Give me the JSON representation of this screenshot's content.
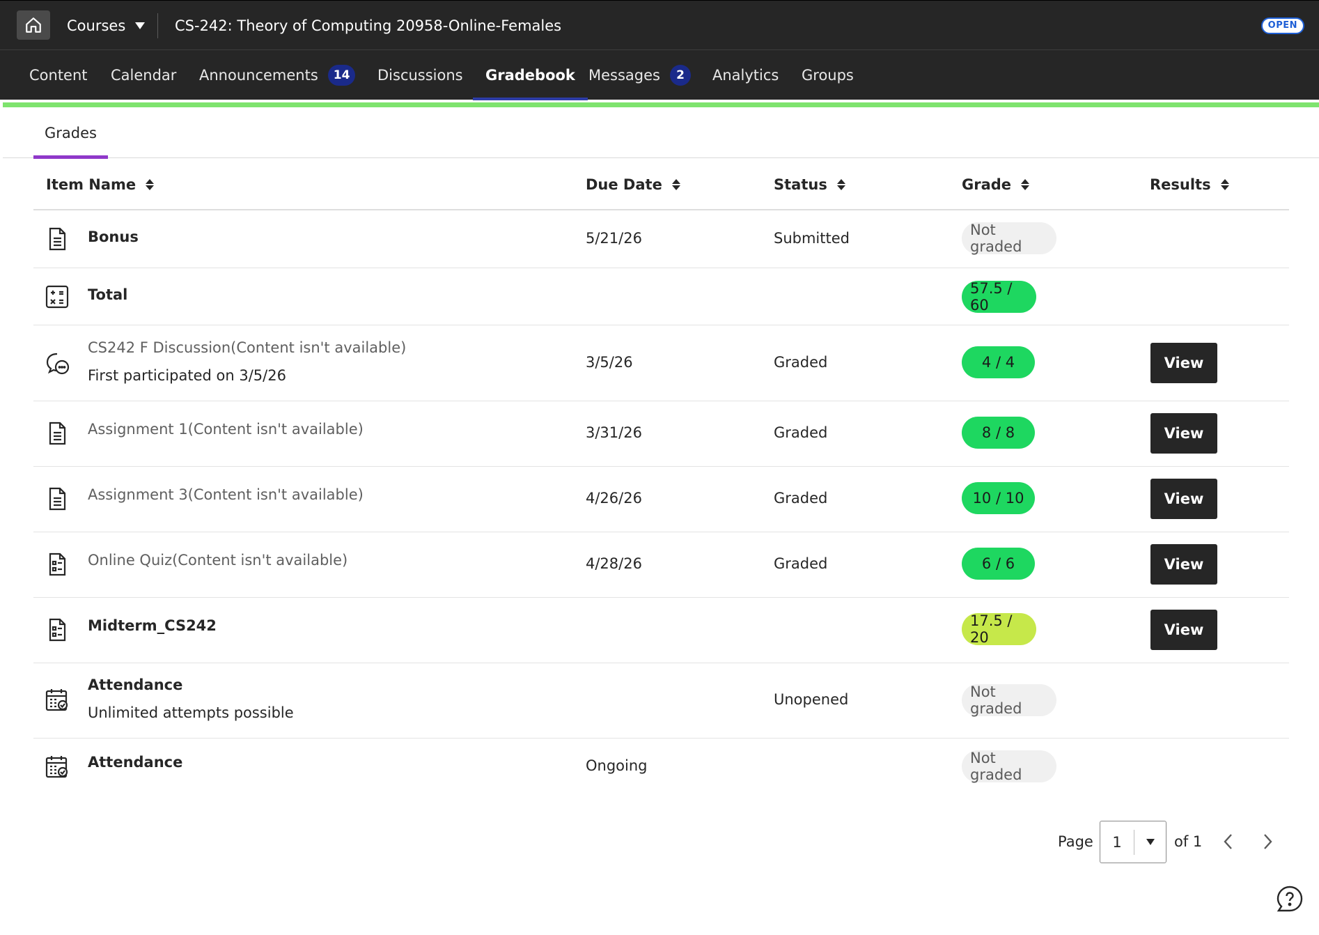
{
  "header": {
    "courses_label": "Courses",
    "course_title": "CS-242: Theory of Computing 20958-Online-Females",
    "status_badge": "OPEN"
  },
  "nav": {
    "items": [
      {
        "label": "Content"
      },
      {
        "label": "Calendar"
      },
      {
        "label": "Announcements",
        "badge": "14"
      },
      {
        "label": "Discussions"
      },
      {
        "label": "Gradebook",
        "active": true
      },
      {
        "label": "Messages",
        "badge": "2"
      },
      {
        "label": "Analytics"
      },
      {
        "label": "Groups"
      }
    ]
  },
  "tabs": [
    {
      "label": "Grades",
      "active": true
    }
  ],
  "table": {
    "columns": [
      "Item Name",
      "Due Date",
      "Status",
      "Grade",
      "Results"
    ],
    "rows": [
      {
        "icon": "document-icon",
        "name": "Bonus",
        "sub": "",
        "due": "5/21/26",
        "status": "Submitted",
        "grade": "Not graded",
        "grade_style": "grey",
        "action": ""
      },
      {
        "icon": "calculator-icon",
        "name": "Total",
        "sub": "",
        "due": "",
        "status": "",
        "grade": "57.5 / 60",
        "grade_style": "green",
        "action": ""
      },
      {
        "icon": "discussion-icon",
        "name": "CS242 F Discussion(Content isn't available)",
        "sub": "First participated on 3/5/26",
        "due": "3/5/26",
        "status": "Graded",
        "grade": "4 / 4",
        "grade_style": "green",
        "action": "View"
      },
      {
        "icon": "document-icon",
        "name": "Assignment 1(Content isn't available)",
        "sub": "",
        "due": "3/31/26",
        "status": "Graded",
        "grade": "8 / 8",
        "grade_style": "green",
        "action": "View"
      },
      {
        "icon": "document-icon",
        "name": "Assignment 3(Content isn't available)",
        "sub": "",
        "due": "4/26/26",
        "status": "Graded",
        "grade": "10 / 10",
        "grade_style": "green",
        "action": "View"
      },
      {
        "icon": "quiz-icon",
        "name": "Online Quiz(Content isn't available)",
        "sub": "",
        "due": "4/28/26",
        "status": "Graded",
        "grade": "6 / 6",
        "grade_style": "green",
        "action": "View"
      },
      {
        "icon": "quiz-icon",
        "name": "Midterm_CS242",
        "sub": "",
        "due": "",
        "status": "",
        "grade": "17.5 / 20",
        "grade_style": "lime",
        "action": "View"
      },
      {
        "icon": "attendance-icon",
        "name": "Attendance",
        "sub": "Unlimited attempts possible",
        "due": "",
        "status": "Unopened",
        "grade": "Not graded",
        "grade_style": "grey",
        "action": ""
      },
      {
        "icon": "attendance-icon",
        "name": "Attendance",
        "sub": "",
        "due": "Ongoing",
        "status": "",
        "grade": "Not graded",
        "grade_style": "grey",
        "action": ""
      }
    ]
  },
  "pagination": {
    "page_label": "Page",
    "current_page": "1",
    "of_label": "of 1"
  },
  "colors": {
    "topbar": "#262626",
    "accent_strip": "#7ee36e",
    "tab_underline": "#8f38c9",
    "badge": "#1a2a8a",
    "grade_green": "#1ed760",
    "grade_lime": "#c6e84a"
  }
}
